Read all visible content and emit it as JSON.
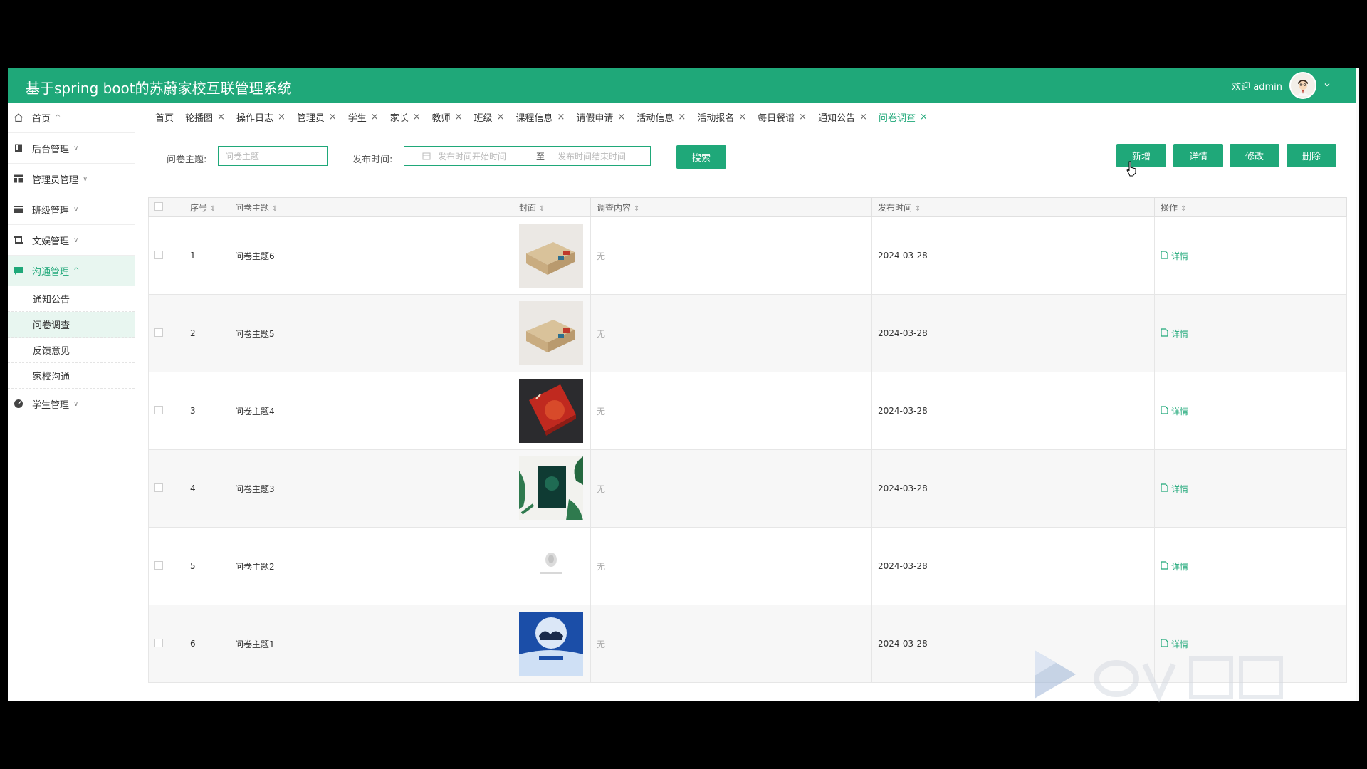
{
  "app_title": "基于spring boot的苏蔚家校互联管理系统",
  "user": {
    "welcome": "欢迎 admin"
  },
  "sidebar": {
    "items": [
      {
        "label": "首页",
        "icon": "home-icon"
      },
      {
        "label": "后台管理",
        "icon": "book-icon"
      },
      {
        "label": "管理员管理",
        "icon": "layout-icon"
      },
      {
        "label": "班级管理",
        "icon": "card-icon"
      },
      {
        "label": "文娱管理",
        "icon": "crop-icon"
      },
      {
        "label": "沟通管理",
        "icon": "chat-icon"
      },
      {
        "label": "学生管理",
        "icon": "gauge-icon"
      }
    ],
    "submenu": [
      {
        "label": "通知公告"
      },
      {
        "label": "问卷调查"
      },
      {
        "label": "反馈意见"
      },
      {
        "label": "家校沟通"
      }
    ]
  },
  "tabs": [
    {
      "label": "首页"
    },
    {
      "label": "轮播图"
    },
    {
      "label": "操作日志"
    },
    {
      "label": "管理员"
    },
    {
      "label": "学生"
    },
    {
      "label": "家长"
    },
    {
      "label": "教师"
    },
    {
      "label": "班级"
    },
    {
      "label": "课程信息"
    },
    {
      "label": "请假申请"
    },
    {
      "label": "活动信息"
    },
    {
      "label": "活动报名"
    },
    {
      "label": "每日餐谱"
    },
    {
      "label": "通知公告"
    },
    {
      "label": "问卷调查"
    }
  ],
  "search": {
    "topic_label": "问卷主题:",
    "topic_placeholder": "问卷主题",
    "time_label": "发布时间:",
    "start_placeholder": "发布时间开始时间",
    "separator": "至",
    "end_placeholder": "发布时间结束时间",
    "search_button": "搜索"
  },
  "toolbar": {
    "add": "新增",
    "detail": "详情",
    "edit": "修改",
    "delete": "删除"
  },
  "table": {
    "columns": {
      "index": "序号",
      "topic": "问卷主题",
      "cover": "封面",
      "content": "调查内容",
      "time": "发布时间",
      "action": "操作"
    },
    "rows": [
      {
        "index": "1",
        "topic": "问卷主题6",
        "content": "无",
        "time": "2024-03-28",
        "action": "详情"
      },
      {
        "index": "2",
        "topic": "问卷主题5",
        "content": "无",
        "time": "2024-03-28",
        "action": "详情"
      },
      {
        "index": "3",
        "topic": "问卷主题4",
        "content": "无",
        "time": "2024-03-28",
        "action": "详情"
      },
      {
        "index": "4",
        "topic": "问卷主题3",
        "content": "无",
        "time": "2024-03-28",
        "action": "详情"
      },
      {
        "index": "5",
        "topic": "问卷主题2",
        "content": "无",
        "time": "2024-03-28",
        "action": "详情"
      },
      {
        "index": "6",
        "topic": "问卷主题1",
        "content": "无",
        "time": "2024-03-28",
        "action": "详情"
      }
    ]
  },
  "colors": {
    "accent": "#1fa879",
    "active_bg": "#e8f6f0"
  }
}
